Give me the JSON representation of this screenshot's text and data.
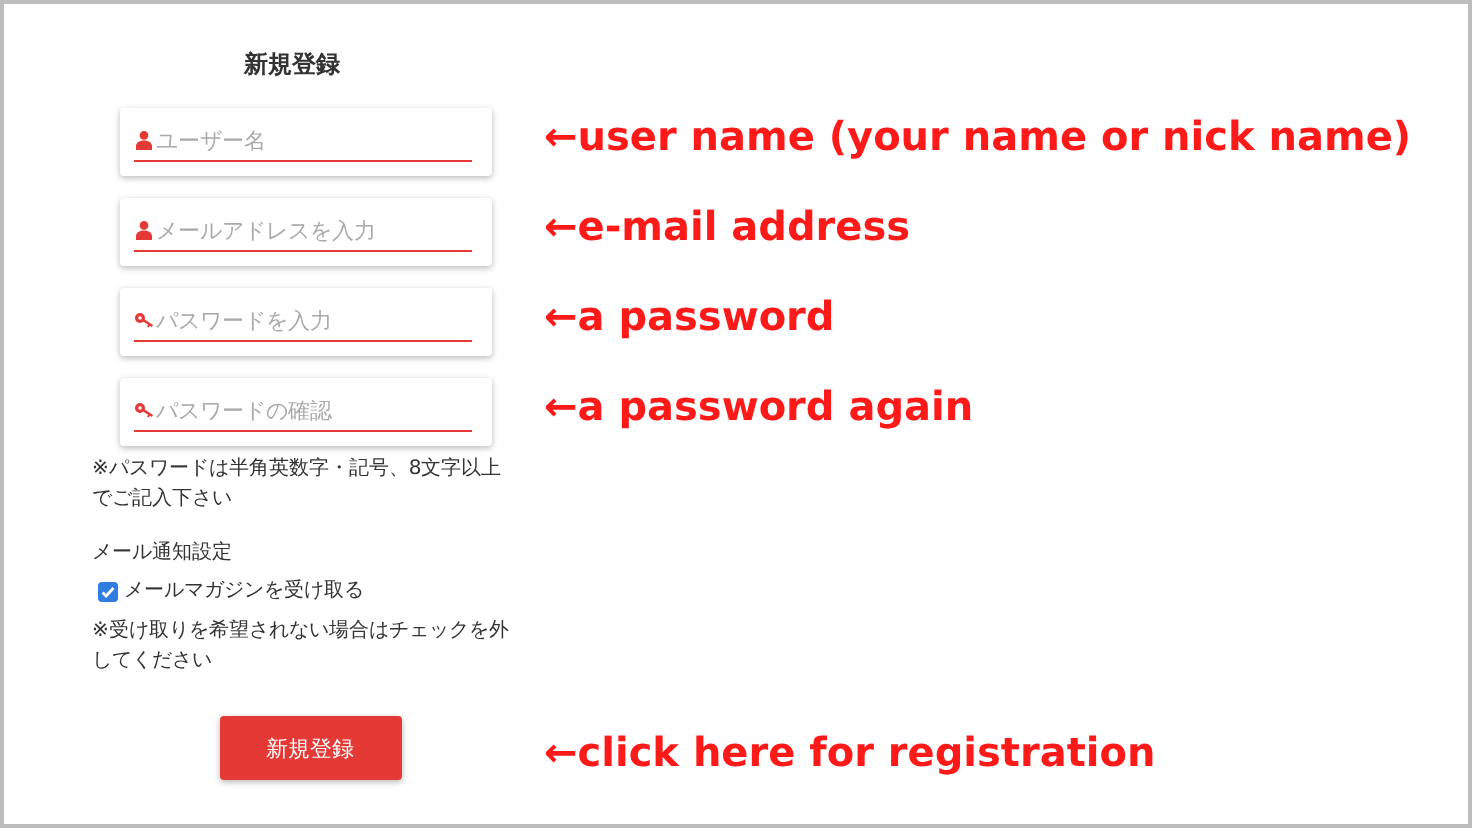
{
  "title": "新規登録",
  "fields": [
    {
      "kind": "user",
      "placeholder": "ユーザー名",
      "annotation": "←user name (your name or nick name)"
    },
    {
      "kind": "user",
      "placeholder": "メールアドレスを入力",
      "annotation": "←e-mail address"
    },
    {
      "kind": "key",
      "placeholder": "パスワードを入力",
      "annotation": "←a password"
    },
    {
      "kind": "key",
      "placeholder": "パスワードの確認",
      "annotation": "←a password again"
    }
  ],
  "password_note": "※パスワードは半角英数字・記号、8文字以上でご記入下さい",
  "mail_settings": {
    "heading": "メール通知設定",
    "checkbox": {
      "label": "メールマガジンを受け取る",
      "checked": true
    },
    "note": "※受け取りを希望されない場合はチェックを外してください"
  },
  "submit": {
    "label": "新規登録",
    "annotation": "←click here for registration"
  }
}
